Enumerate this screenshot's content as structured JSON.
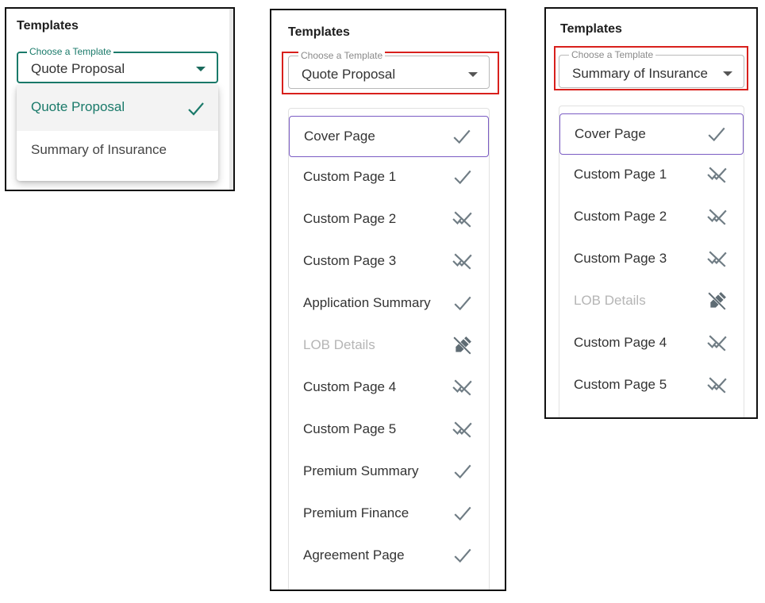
{
  "panel1": {
    "title": "Templates",
    "field_legend": "Choose a Template",
    "field_value": "Quote Proposal",
    "options": [
      {
        "label": "Quote Proposal",
        "selected": true
      },
      {
        "label": "Summary of Insurance",
        "selected": false
      }
    ]
  },
  "panel2": {
    "title": "Templates",
    "field_legend": "Choose a Template",
    "field_value": "Quote Proposal",
    "pages": [
      {
        "label": "Cover Page",
        "status": "check-icon",
        "active": true
      },
      {
        "label": "Custom Page 1",
        "status": "check-icon"
      },
      {
        "label": "Custom Page 2",
        "status": "double-check-disabled-icon"
      },
      {
        "label": "Custom Page 3",
        "status": "double-check-disabled-icon"
      },
      {
        "label": "Application Summary",
        "status": "check-icon"
      },
      {
        "label": "LOB Details",
        "status": "edit-off-icon",
        "disabled": true
      },
      {
        "label": "Custom Page 4",
        "status": "double-check-disabled-icon"
      },
      {
        "label": "Custom Page 5",
        "status": "double-check-disabled-icon"
      },
      {
        "label": "Premium Summary",
        "status": "check-icon"
      },
      {
        "label": "Premium Finance",
        "status": "check-icon"
      },
      {
        "label": "Agreement Page",
        "status": "check-icon"
      }
    ]
  },
  "panel3": {
    "title": "Templates",
    "field_legend": "Choose a Template",
    "field_value": "Summary of Insurance",
    "pages": [
      {
        "label": "Cover Page",
        "status": "check-icon",
        "active": true
      },
      {
        "label": "Custom Page 1",
        "status": "double-check-disabled-icon"
      },
      {
        "label": "Custom Page 2",
        "status": "double-check-disabled-icon"
      },
      {
        "label": "Custom Page 3",
        "status": "double-check-disabled-icon"
      },
      {
        "label": "LOB Details",
        "status": "edit-off-icon",
        "disabled": true
      },
      {
        "label": "Custom Page 4",
        "status": "double-check-disabled-icon"
      },
      {
        "label": "Custom Page 5",
        "status": "double-check-disabled-icon"
      }
    ]
  },
  "colors": {
    "accent": "#1a7a6a",
    "active_border": "#7b5cc4",
    "highlight_box": "#d8201c",
    "icon_gray": "#6f7c84"
  }
}
